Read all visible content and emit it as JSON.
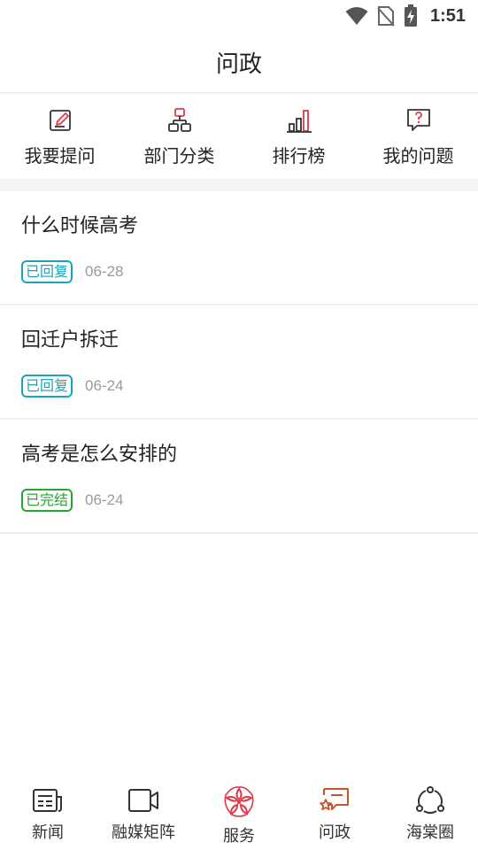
{
  "status_bar": {
    "time": "1:51",
    "icons": [
      "wifi-icon",
      "no-sim-icon",
      "battery-charging-icon"
    ]
  },
  "header": {
    "title": "问政"
  },
  "quick_nav": [
    {
      "label": "我要提问",
      "icon": "edit-icon"
    },
    {
      "label": "部门分类",
      "icon": "org-chart-icon"
    },
    {
      "label": "排行榜",
      "icon": "bar-chart-icon"
    },
    {
      "label": "我的问题",
      "icon": "question-bubble-icon"
    }
  ],
  "questions": [
    {
      "title": "什么时候高考",
      "status": "已回复",
      "date": "06-28"
    },
    {
      "title": "回迁户拆迁",
      "status": "已回复",
      "date": "06-24"
    },
    {
      "title": "高考是怎么安排的",
      "status": "已完结",
      "date": "06-24"
    }
  ],
  "bottom_nav": [
    {
      "label": "新闻",
      "icon": "newspaper-icon"
    },
    {
      "label": "融媒矩阵",
      "icon": "video-camera-icon"
    },
    {
      "label": "服务",
      "icon": "begonia-flower-icon"
    },
    {
      "label": "问政",
      "icon": "chat-star-icon",
      "active": true
    },
    {
      "label": "海棠圈",
      "icon": "circle-share-icon"
    }
  ],
  "colors": {
    "accent": "#c4542c",
    "replied": "#1aa3bb",
    "closed": "#2aa336",
    "icon_red": "#e0394a"
  }
}
